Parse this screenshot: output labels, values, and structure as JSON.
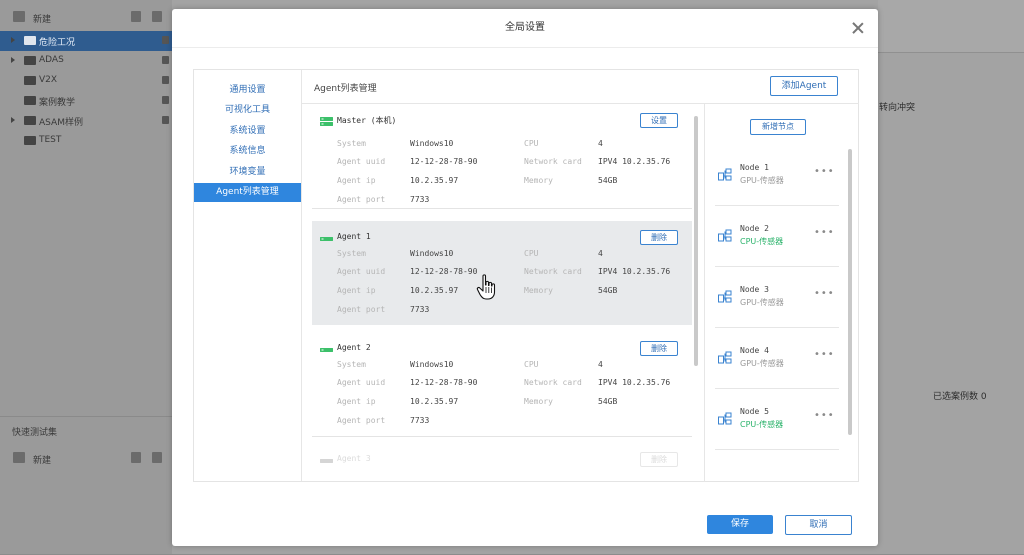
{
  "background": {
    "sidebar": {
      "new_label": "新建",
      "tree": [
        {
          "label": "危险工况",
          "selected": true,
          "expandable": true
        },
        {
          "label": "ADAS",
          "selected": false,
          "expandable": true
        },
        {
          "label": "V2X",
          "selected": false,
          "expandable": false
        },
        {
          "label": "案例教学",
          "selected": false,
          "expandable": false
        },
        {
          "label": "ASAM样例",
          "selected": false,
          "expandable": true
        },
        {
          "label": "TEST",
          "selected": false,
          "expandable": false
        }
      ],
      "quick_title": "快速测试集",
      "quick_new": "新建"
    },
    "right_text_1": "转向冲突",
    "right_text_2": "已选案例数 0"
  },
  "modal": {
    "title": "全局设置",
    "nav": [
      {
        "label": "通用设置",
        "active": false
      },
      {
        "label": "可视化工具",
        "active": false
      },
      {
        "label": "系统设置",
        "active": false
      },
      {
        "label": "系统信息",
        "active": false
      },
      {
        "label": "环境变量",
        "active": false
      },
      {
        "label": "Agent列表管理",
        "active": true
      }
    ],
    "content_title": "Agent列表管理",
    "add_agent_label": "添加Agent",
    "add_node_label": "新增节点",
    "field_labels": {
      "system": "System",
      "uuid": "Agent uuid",
      "ip": "Agent ip",
      "port": "Agent port",
      "cpu": "CPU",
      "network": "Network card",
      "memory": "Memory"
    },
    "agents": [
      {
        "name": "Master (本机)",
        "action": "设置",
        "system": "Windows10",
        "uuid": "12-12-28-78-90",
        "ip": "10.2.35.97",
        "port": "7733",
        "cpu": "4",
        "network": "IPV4 10.2.35.76",
        "memory": "54GB"
      },
      {
        "name": "Agent 1",
        "action": "删除",
        "system": "Windows10",
        "uuid": "12-12-28-78-90",
        "ip": "10.2.35.97",
        "port": "7733",
        "cpu": "4",
        "network": "IPV4 10.2.35.76",
        "memory": "54GB"
      },
      {
        "name": "Agent 2",
        "action": "删除",
        "system": "Windows10",
        "uuid": "12-12-28-78-90",
        "ip": "10.2.35.97",
        "port": "7733",
        "cpu": "4",
        "network": "IPV4 10.2.35.76",
        "memory": "54GB"
      },
      {
        "name": "Agent 3",
        "action": "删除"
      }
    ],
    "nodes": [
      {
        "name": "Node 1",
        "type": "GPU-传感器",
        "active": false
      },
      {
        "name": "Node 2",
        "type": "CPU-传感器",
        "active": true
      },
      {
        "name": "Node 3",
        "type": "GPU-传感器",
        "active": false
      },
      {
        "name": "Node 4",
        "type": "GPU-传感器",
        "active": false
      },
      {
        "name": "Node 5",
        "type": "CPU-传感器",
        "active": true
      }
    ],
    "more_label": "•••",
    "save_label": "保存",
    "cancel_label": "取消"
  },
  "colors": {
    "accent": "#2f86de",
    "online": "#2bb36b",
    "master_icon": "#3cc06a"
  }
}
